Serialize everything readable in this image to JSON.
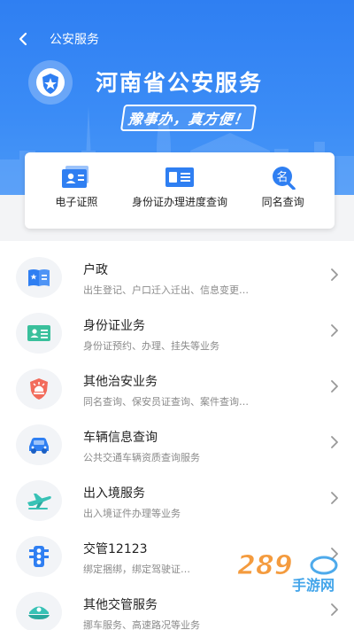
{
  "header": {
    "nav_title": "公安服务",
    "main_title": "河南省公安服务",
    "slogan": "豫事办，真方便！"
  },
  "quick_actions": [
    {
      "label": "电子证照",
      "icon": "id-card-icon"
    },
    {
      "label": "身份证办理进度查询",
      "icon": "id-progress-icon"
    },
    {
      "label": "同名查询",
      "icon": "name-search-icon"
    }
  ],
  "services": [
    {
      "title": "户政",
      "subtitle": "出生登记、户口迁入迁出、信息变更…",
      "icon": "household-book-icon"
    },
    {
      "title": "身份证业务",
      "subtitle": "身份证预约、办理、挂失等业务",
      "icon": "id-card-icon"
    },
    {
      "title": "其他治安业务",
      "subtitle": "同名查询、保安员证查询、案件查询…",
      "icon": "police-shield-icon"
    },
    {
      "title": "车辆信息查询",
      "subtitle": "公共交通车辆资质查询服务",
      "icon": "car-icon"
    },
    {
      "title": "出入境服务",
      "subtitle": "出入境证件办理等业务",
      "icon": "airplane-icon"
    },
    {
      "title": "交管12123",
      "subtitle": "绑定捆绑，绑定驾驶证…",
      "icon": "traffic-light-icon"
    },
    {
      "title": "其他交管服务",
      "subtitle": "挪车服务、高速路况等业务",
      "icon": "police-cap-icon"
    }
  ],
  "watermark": {
    "text_top": "289",
    "text_bottom": "手游网"
  },
  "colors": {
    "brand_blue": "#2f7ff2",
    "icon_blue": "#2f7ff2",
    "alert_red": "#f26b5b",
    "plane_teal": "#38c2b6"
  }
}
